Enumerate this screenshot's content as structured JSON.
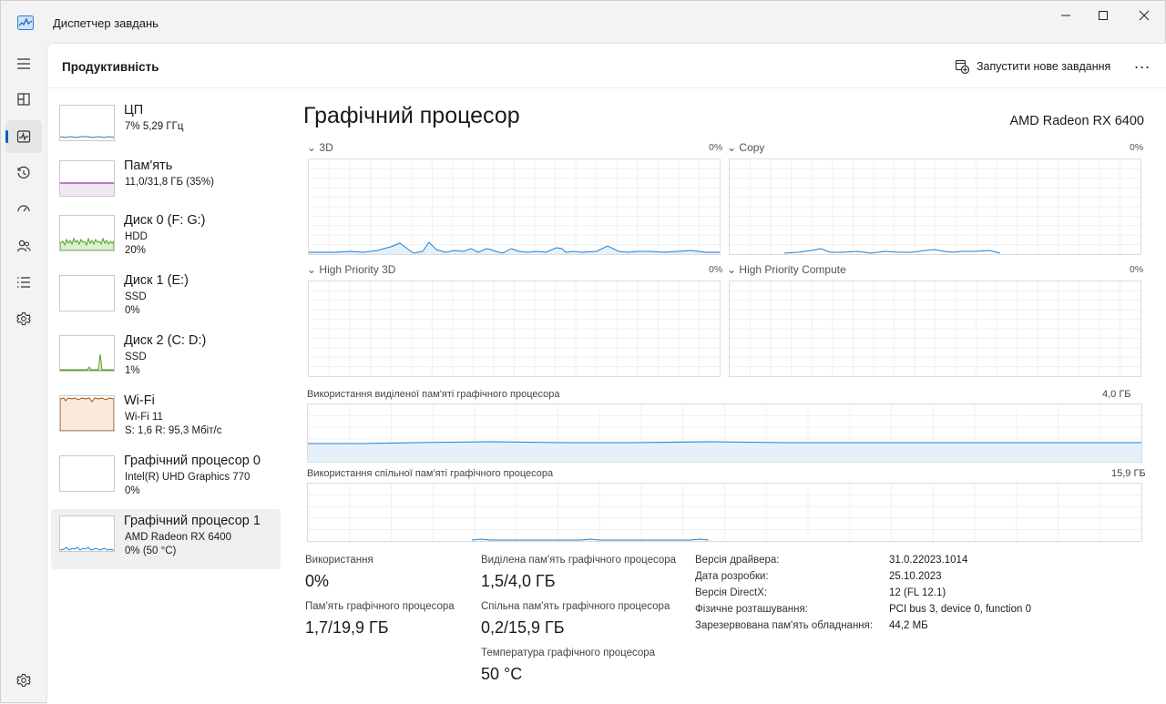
{
  "window": {
    "title": "Диспетчер завдань",
    "minimize_icon": "minimize-icon",
    "maximize_icon": "maximize-icon",
    "close_icon": "close-icon"
  },
  "nav": {
    "items": [
      "hamburger-menu-icon",
      "processes-icon",
      "performance-icon",
      "app-history-icon",
      "startup-apps-icon",
      "users-icon",
      "details-icon",
      "services-icon"
    ],
    "settings_icon": "settings-icon",
    "accent": "#005fb8"
  },
  "header": {
    "title": "Продуктивність",
    "run_new_task": "Запустити нове завдання",
    "more": "..."
  },
  "devices": [
    {
      "name": "ЦП",
      "sub1": "7%  5,29 ГГц",
      "sub2": "",
      "color": "#1f7fd1"
    },
    {
      "name": "Пам'ять",
      "sub1": "11,0/31,8 ГБ (35%)",
      "sub2": "",
      "color": "#9b2fae"
    },
    {
      "name": "Диск 0 (F: G:)",
      "sub1": "HDD",
      "sub2": "20%",
      "color": "#4ca11b"
    },
    {
      "name": "Диск 1 (E:)",
      "sub1": "SSD",
      "sub2": "0%",
      "color": "#4ca11b"
    },
    {
      "name": "Диск 2 (C: D:)",
      "sub1": "SSD",
      "sub2": "1%",
      "color": "#4ca11b"
    },
    {
      "name": "Wi-Fi",
      "sub1": "Wi-Fi 11",
      "sub2": "S: 1,6  R: 95,3 Мбіт/с",
      "color": "#a74f01"
    },
    {
      "name": "Графічний процесор 0",
      "sub1": "Intel(R) UHD Graphics 770",
      "sub2": "0%",
      "color": "#1f7fd1"
    },
    {
      "name": "Графічний процесор 1",
      "sub1": "AMD Radeon RX 6400",
      "sub2": "0%  (50 °C)",
      "color": "#1f7fd1"
    }
  ],
  "main": {
    "title": "Графічний процесор",
    "model": "AMD Radeon RX 6400",
    "graphs": {
      "g3d": {
        "label": "3D",
        "pct": "0%"
      },
      "copy": {
        "label": "Copy",
        "pct": "0%"
      },
      "hp3d": {
        "label": "High Priority 3D",
        "pct": "0%"
      },
      "hpcompute": {
        "label": "High Priority Compute",
        "pct": "0%"
      }
    },
    "dedicated": {
      "label": "Використання виділеної пам'яті графічного процесора",
      "max": "4,0 ГБ"
    },
    "shared": {
      "label": "Використання спільної пам'яті графічного процесора",
      "max": "15,9 ГБ"
    },
    "stats": {
      "usage_label": "Використання",
      "usage_value": "0%",
      "ded_label": "Виділена пам'ять графічного процесора",
      "ded_value": "1,5/4,0 ГБ",
      "gpumem_label": "Пам'ять графічного процесора",
      "gpumem_value": "1,7/19,9 ГБ",
      "shared_label": "Спільна пам'ять графічного процесора",
      "shared_value": "0,2/15,9 ГБ",
      "temp_label": "Температура графічного процесора",
      "temp_value": "50 °C"
    },
    "info": [
      {
        "key": "Версія драйвера:",
        "value": "31.0.22023.1014"
      },
      {
        "key": "Дата розробки:",
        "value": "25.10.2023"
      },
      {
        "key": "Версія DirectX:",
        "value": "12 (FL 12.1)"
      },
      {
        "key": "Фізичне розташування:",
        "value": "PCI bus 3, device 0, function 0"
      },
      {
        "key": "Зарезервована пам'ять обладнання:",
        "value": "44,2 МБ"
      }
    ],
    "graph_color": "#1f7fd1"
  }
}
